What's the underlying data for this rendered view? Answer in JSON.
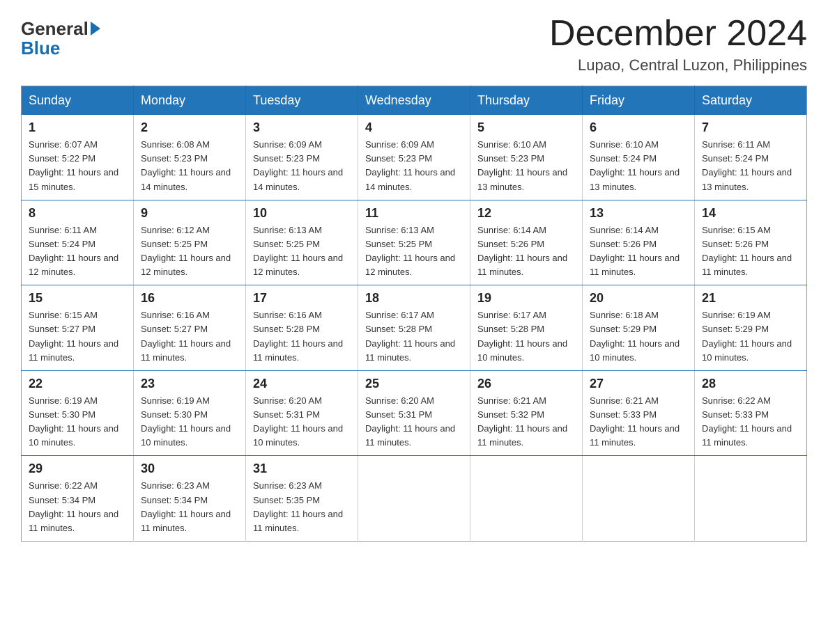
{
  "header": {
    "logo_general": "General",
    "logo_blue": "Blue",
    "month_title": "December 2024",
    "location": "Lupao, Central Luzon, Philippines"
  },
  "days_of_week": [
    "Sunday",
    "Monday",
    "Tuesday",
    "Wednesday",
    "Thursday",
    "Friday",
    "Saturday"
  ],
  "weeks": [
    [
      {
        "day": "1",
        "sunrise": "6:07 AM",
        "sunset": "5:22 PM",
        "daylight": "11 hours and 15 minutes."
      },
      {
        "day": "2",
        "sunrise": "6:08 AM",
        "sunset": "5:23 PM",
        "daylight": "11 hours and 14 minutes."
      },
      {
        "day": "3",
        "sunrise": "6:09 AM",
        "sunset": "5:23 PM",
        "daylight": "11 hours and 14 minutes."
      },
      {
        "day": "4",
        "sunrise": "6:09 AM",
        "sunset": "5:23 PM",
        "daylight": "11 hours and 14 minutes."
      },
      {
        "day": "5",
        "sunrise": "6:10 AM",
        "sunset": "5:23 PM",
        "daylight": "11 hours and 13 minutes."
      },
      {
        "day": "6",
        "sunrise": "6:10 AM",
        "sunset": "5:24 PM",
        "daylight": "11 hours and 13 minutes."
      },
      {
        "day": "7",
        "sunrise": "6:11 AM",
        "sunset": "5:24 PM",
        "daylight": "11 hours and 13 minutes."
      }
    ],
    [
      {
        "day": "8",
        "sunrise": "6:11 AM",
        "sunset": "5:24 PM",
        "daylight": "11 hours and 12 minutes."
      },
      {
        "day": "9",
        "sunrise": "6:12 AM",
        "sunset": "5:25 PM",
        "daylight": "11 hours and 12 minutes."
      },
      {
        "day": "10",
        "sunrise": "6:13 AM",
        "sunset": "5:25 PM",
        "daylight": "11 hours and 12 minutes."
      },
      {
        "day": "11",
        "sunrise": "6:13 AM",
        "sunset": "5:25 PM",
        "daylight": "11 hours and 12 minutes."
      },
      {
        "day": "12",
        "sunrise": "6:14 AM",
        "sunset": "5:26 PM",
        "daylight": "11 hours and 11 minutes."
      },
      {
        "day": "13",
        "sunrise": "6:14 AM",
        "sunset": "5:26 PM",
        "daylight": "11 hours and 11 minutes."
      },
      {
        "day": "14",
        "sunrise": "6:15 AM",
        "sunset": "5:26 PM",
        "daylight": "11 hours and 11 minutes."
      }
    ],
    [
      {
        "day": "15",
        "sunrise": "6:15 AM",
        "sunset": "5:27 PM",
        "daylight": "11 hours and 11 minutes."
      },
      {
        "day": "16",
        "sunrise": "6:16 AM",
        "sunset": "5:27 PM",
        "daylight": "11 hours and 11 minutes."
      },
      {
        "day": "17",
        "sunrise": "6:16 AM",
        "sunset": "5:28 PM",
        "daylight": "11 hours and 11 minutes."
      },
      {
        "day": "18",
        "sunrise": "6:17 AM",
        "sunset": "5:28 PM",
        "daylight": "11 hours and 11 minutes."
      },
      {
        "day": "19",
        "sunrise": "6:17 AM",
        "sunset": "5:28 PM",
        "daylight": "11 hours and 10 minutes."
      },
      {
        "day": "20",
        "sunrise": "6:18 AM",
        "sunset": "5:29 PM",
        "daylight": "11 hours and 10 minutes."
      },
      {
        "day": "21",
        "sunrise": "6:19 AM",
        "sunset": "5:29 PM",
        "daylight": "11 hours and 10 minutes."
      }
    ],
    [
      {
        "day": "22",
        "sunrise": "6:19 AM",
        "sunset": "5:30 PM",
        "daylight": "11 hours and 10 minutes."
      },
      {
        "day": "23",
        "sunrise": "6:19 AM",
        "sunset": "5:30 PM",
        "daylight": "11 hours and 10 minutes."
      },
      {
        "day": "24",
        "sunrise": "6:20 AM",
        "sunset": "5:31 PM",
        "daylight": "11 hours and 10 minutes."
      },
      {
        "day": "25",
        "sunrise": "6:20 AM",
        "sunset": "5:31 PM",
        "daylight": "11 hours and 11 minutes."
      },
      {
        "day": "26",
        "sunrise": "6:21 AM",
        "sunset": "5:32 PM",
        "daylight": "11 hours and 11 minutes."
      },
      {
        "day": "27",
        "sunrise": "6:21 AM",
        "sunset": "5:33 PM",
        "daylight": "11 hours and 11 minutes."
      },
      {
        "day": "28",
        "sunrise": "6:22 AM",
        "sunset": "5:33 PM",
        "daylight": "11 hours and 11 minutes."
      }
    ],
    [
      {
        "day": "29",
        "sunrise": "6:22 AM",
        "sunset": "5:34 PM",
        "daylight": "11 hours and 11 minutes."
      },
      {
        "day": "30",
        "sunrise": "6:23 AM",
        "sunset": "5:34 PM",
        "daylight": "11 hours and 11 minutes."
      },
      {
        "day": "31",
        "sunrise": "6:23 AM",
        "sunset": "5:35 PM",
        "daylight": "11 hours and 11 minutes."
      },
      null,
      null,
      null,
      null
    ]
  ]
}
